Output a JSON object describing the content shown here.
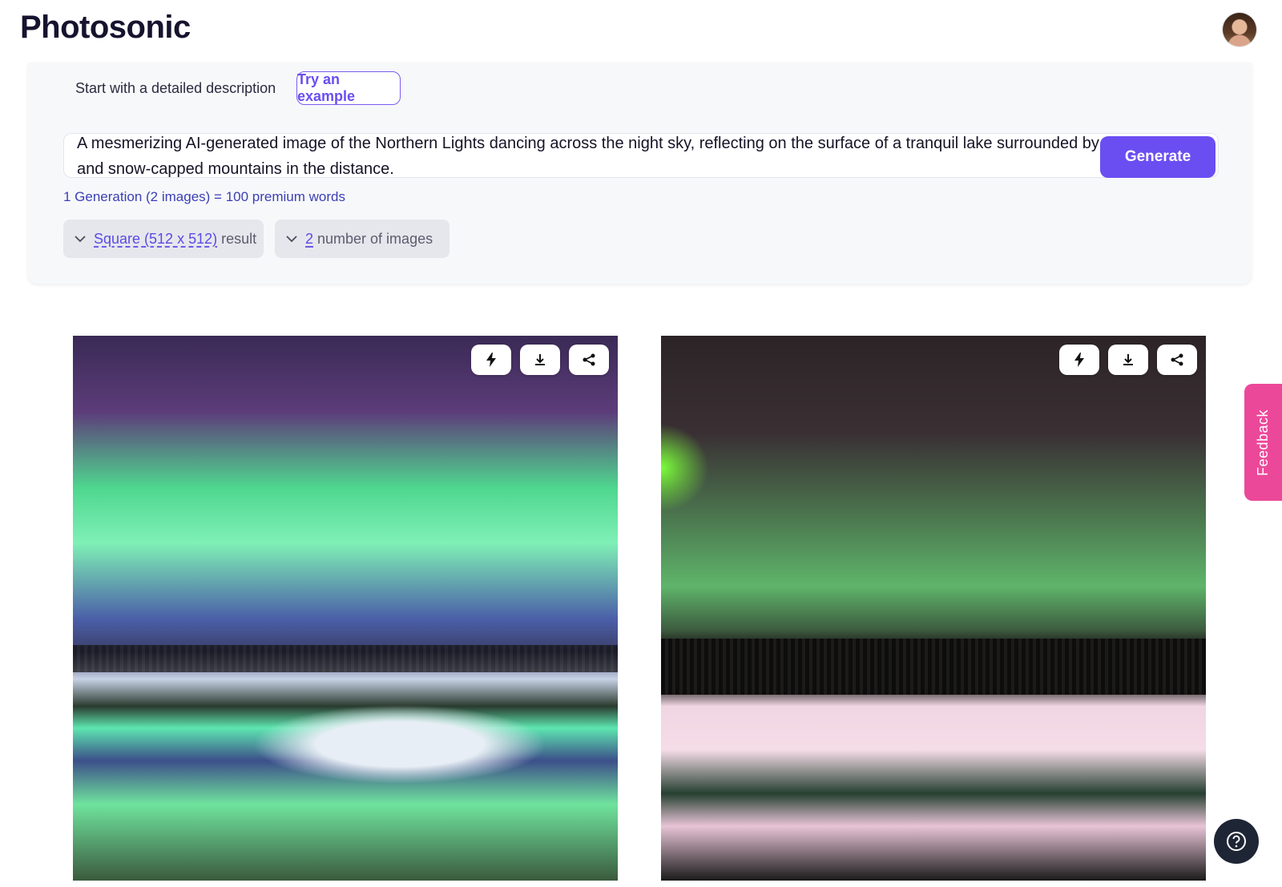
{
  "app": {
    "name": "Photosonic"
  },
  "generator": {
    "start_label": "Start with a detailed description",
    "example_button": "Try an example",
    "prompt_value": "A mesmerizing AI-generated image of the Northern Lights dancing across the night sky, reflecting on the surface of a tranquil lake surrounded by dense forest and snow-capped mountains in the distance.",
    "generate_button": "Generate",
    "cost_note": "1 Generation (2 images) = 100 premium words",
    "size_option": {
      "value": "Square (512 x 512)",
      "suffix": "result"
    },
    "count_option": {
      "value": "2",
      "suffix": "number of images"
    }
  },
  "results": {
    "images": [
      {
        "alt": "Northern lights over mountain lake with pine trees",
        "actions": [
          "bolt-icon",
          "download-icon",
          "share-icon"
        ]
      },
      {
        "alt": "Northern lights over snowy lake and forest",
        "actions": [
          "bolt-icon",
          "download-icon",
          "share-icon"
        ]
      }
    ]
  },
  "feedback_tab": "Feedback",
  "colors": {
    "accent": "#6b4ef2",
    "feedback": "#ec4899",
    "help": "#1e2535"
  }
}
